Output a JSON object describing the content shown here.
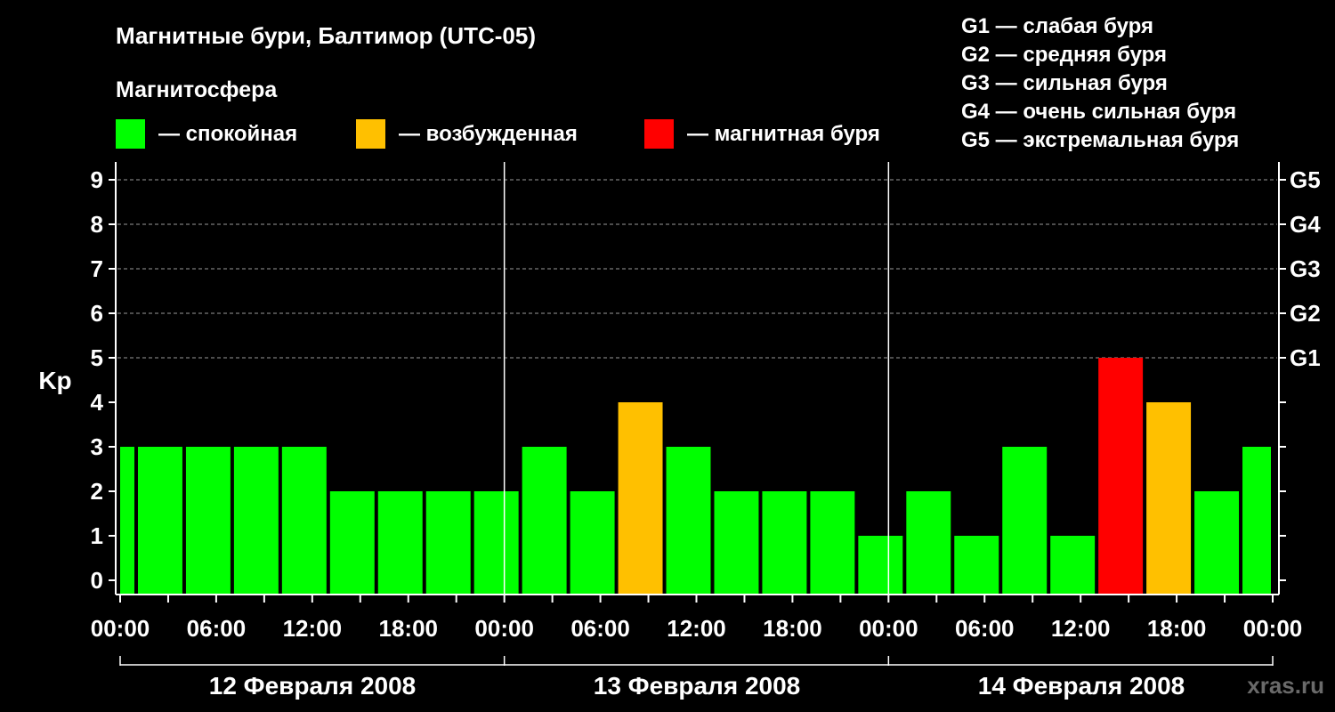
{
  "header": {
    "title": "Магнитные бури, Балтимор (UTC-05)",
    "subtitle": "Магнитосфера"
  },
  "legend": {
    "quiet": "— спокойная",
    "excited": "— возбужденная",
    "storm": "— магнитная буря"
  },
  "g_legend": [
    "G1 — слабая буря",
    "G2 — средняя буря",
    "G3 — сильная буря",
    "G4 — очень сильная буря",
    "G5 — экстремальная буря"
  ],
  "watermark": "xras.ru",
  "colors": {
    "quiet": "#00ff00",
    "excited": "#ffc000",
    "storm": "#ff0000",
    "background": "#000000",
    "foreground": "#ffffff"
  },
  "chart_data": {
    "type": "bar",
    "ylabel": "Kp",
    "ylim": [
      0,
      9
    ],
    "yticks": [
      "0",
      "1",
      "2",
      "3",
      "4",
      "5",
      "6",
      "7",
      "8",
      "9"
    ],
    "right_ticks": [
      {
        "kp": 5,
        "label": "G1"
      },
      {
        "kp": 6,
        "label": "G2"
      },
      {
        "kp": 7,
        "label": "G3"
      },
      {
        "kp": 8,
        "label": "G4"
      },
      {
        "kp": 9,
        "label": "G5"
      }
    ],
    "grid": "dashed horizontal at Kp 5–9",
    "xticks": [
      "00:00",
      "06:00",
      "12:00",
      "18:00",
      "00:00",
      "06:00",
      "12:00",
      "18:00",
      "00:00",
      "06:00",
      "12:00",
      "18:00",
      "00:00"
    ],
    "days": [
      "12 Февраля 2008",
      "13 Февраля 2008",
      "14 Февраля 2008"
    ],
    "values": [
      3,
      3,
      3,
      3,
      3,
      2,
      2,
      2,
      2,
      3,
      2,
      4,
      3,
      2,
      2,
      2,
      1,
      2,
      1,
      3,
      1,
      5,
      4,
      2,
      3
    ],
    "levels": [
      "quiet",
      "quiet",
      "quiet",
      "quiet",
      "quiet",
      "quiet",
      "quiet",
      "quiet",
      "quiet",
      "quiet",
      "quiet",
      "excited",
      "quiet",
      "quiet",
      "quiet",
      "quiet",
      "quiet",
      "quiet",
      "quiet",
      "quiet",
      "quiet",
      "storm",
      "excited",
      "quiet",
      "quiet"
    ]
  }
}
